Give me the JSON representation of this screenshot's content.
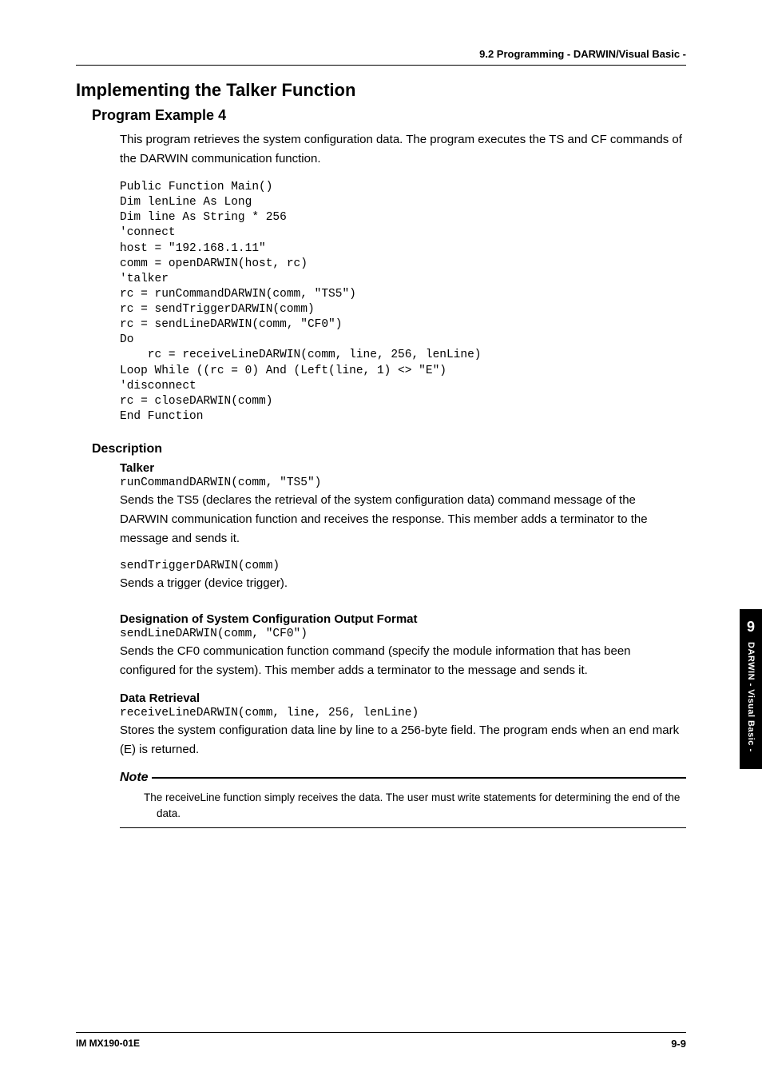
{
  "header": {
    "running": "9.2  Programming - DARWIN/Visual Basic -"
  },
  "title": "Implementing the Talker Function",
  "sec1": {
    "heading": "Program Example 4",
    "intro": "This program retrieves the system configuration data. The program executes the TS and CF commands of the DARWIN communication function.",
    "code": "Public Function Main()\nDim lenLine As Long\nDim line As String * 256\n'connect\nhost = \"192.168.1.11\"\ncomm = openDARWIN(host, rc)\n'talker\nrc = runCommandDARWIN(comm, \"TS5\")\nrc = sendTriggerDARWIN(comm)\nrc = sendLineDARWIN(comm, \"CF0\")\nDo\n    rc = receiveLineDARWIN(comm, line, 256, lenLine)\nLoop While ((rc = 0) And (Left(line, 1) <> \"E\")\n'disconnect\nrc = closeDARWIN(comm)\nEnd Function"
  },
  "desc": {
    "heading": "Description",
    "talker": {
      "title": "Talker",
      "code1": "runCommandDARWIN(comm, \"TS5\")",
      "para1": "Sends the TS5 (declares the retrieval of the system configuration data) command message of the DARWIN communication function and receives the response. This member adds a terminator to the message and sends it.",
      "code2": "sendTriggerDARWIN(comm)",
      "para2": "Sends a trigger (device trigger)."
    },
    "desig": {
      "title": "Designation of System Configuration Output Format",
      "code": "sendLineDARWIN(comm, \"CF0\")",
      "para": "Sends the CF0 communication function command (specify the module information that has been configured for the system). This member adds a terminator to the message and sends it."
    },
    "retrieval": {
      "title": "Data Retrieval",
      "code": "receiveLineDARWIN(comm, line, 256, lenLine)",
      "para": "Stores the system configuration data line by line to a 256-byte field. The program ends when an end mark (E) is returned."
    }
  },
  "note": {
    "label": "Note",
    "text": "The receiveLine function simply receives the data. The user must write statements for determining the end of the data."
  },
  "sidebar": {
    "num": "9",
    "label": "DARWIN - Visual Basic -"
  },
  "footer": {
    "left": "IM MX190-01E",
    "right": "9-9"
  }
}
